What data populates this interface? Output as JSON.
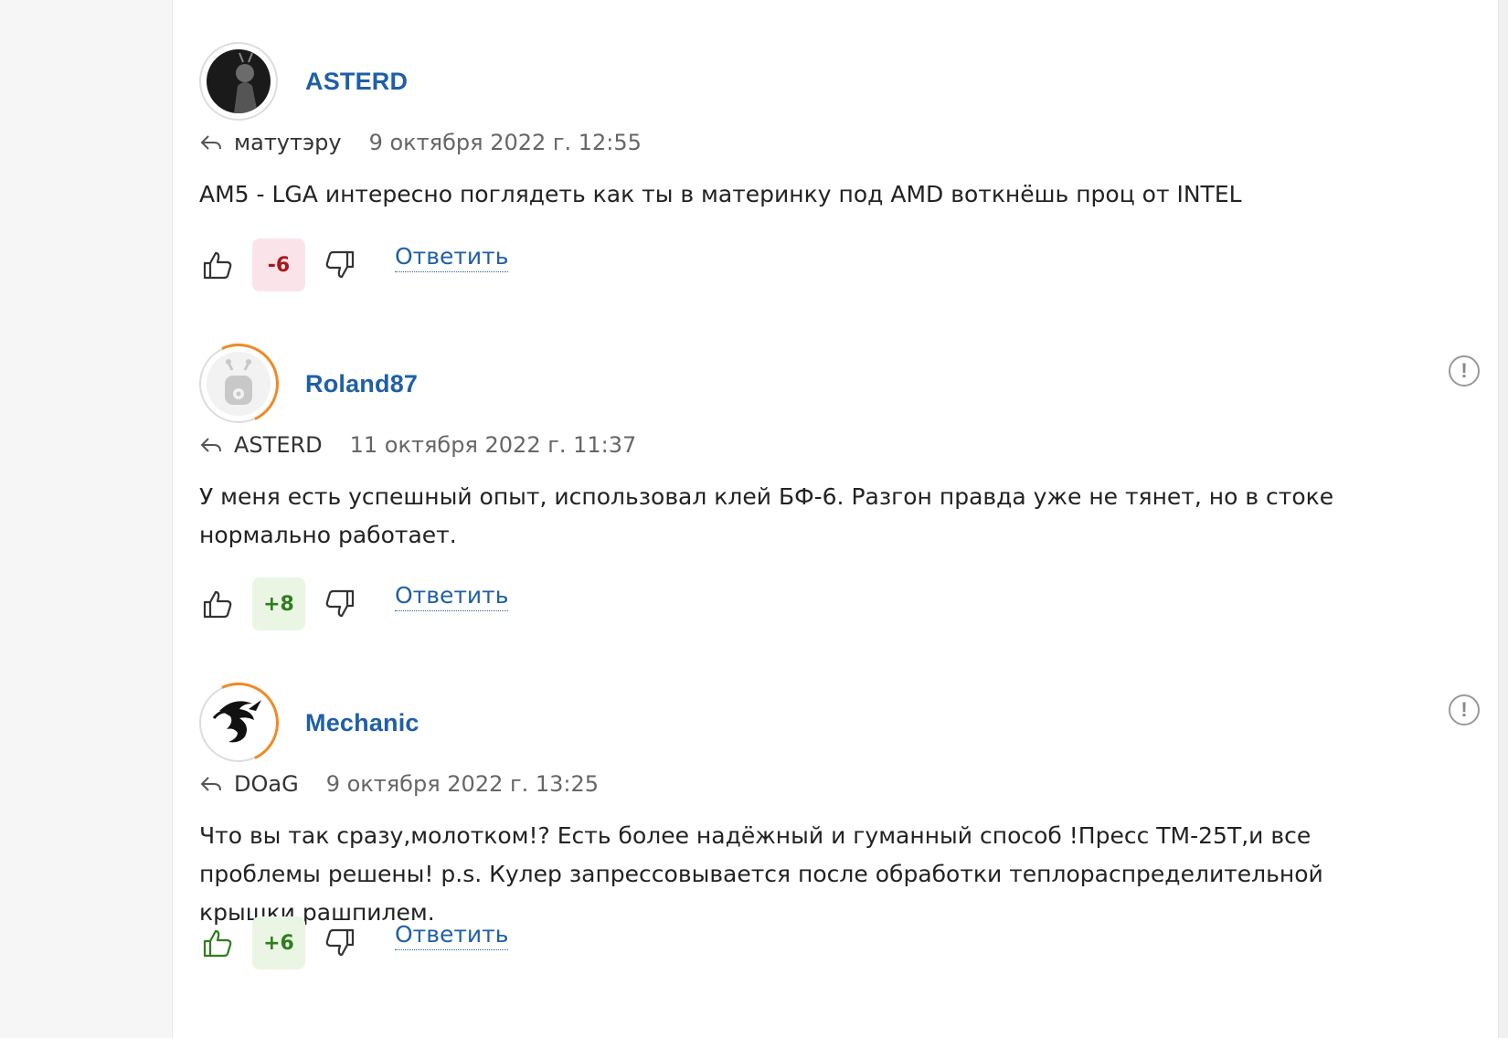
{
  "colors": {
    "link": "#1f5fa8",
    "score_negative_bg": "#fbe4e9",
    "score_negative_text": "#a51b1b",
    "score_positive_bg": "#eaf6e3",
    "score_positive_text": "#2e7d1e",
    "ring": "#f08a24"
  },
  "comments": [
    {
      "author": "ASTERD",
      "avatar_icon": "dark-photo-avatar",
      "reply_to": "матутэру",
      "timestamp": "9 октября 2022 г. 12:55",
      "text": "AM5 - LGA интересно поглядеть как ты в материнку под AMD воткнёшь проц от INTEL",
      "score": "-6",
      "reply_label": "Ответить"
    },
    {
      "author": "Roland87",
      "avatar_icon": "default-robot-avatar",
      "reply_to": "ASTERD",
      "timestamp": "11 октября 2022 г. 11:37",
      "text": "У меня есть успешный опыт, использовал клей БФ-6. Разгон правда уже не тянет, но в стоке нормально работает.",
      "score": "+8",
      "reply_label": "Ответить",
      "report_icon": "!"
    },
    {
      "author": "Mechanic",
      "avatar_icon": "dragon-avatar",
      "reply_to": "DOaG",
      "timestamp": "9 октября 2022 г. 13:25",
      "text": "Что вы так сразу,молотком!? Есть более надёжный и гуманный способ !Пресс ТМ-25Т,и все проблемы решены! p.s. Кулер запрессовывается после обработки теплораспределительной крышки рашпилем.",
      "score": "+6",
      "reply_label": "Ответить",
      "report_icon": "!"
    }
  ]
}
